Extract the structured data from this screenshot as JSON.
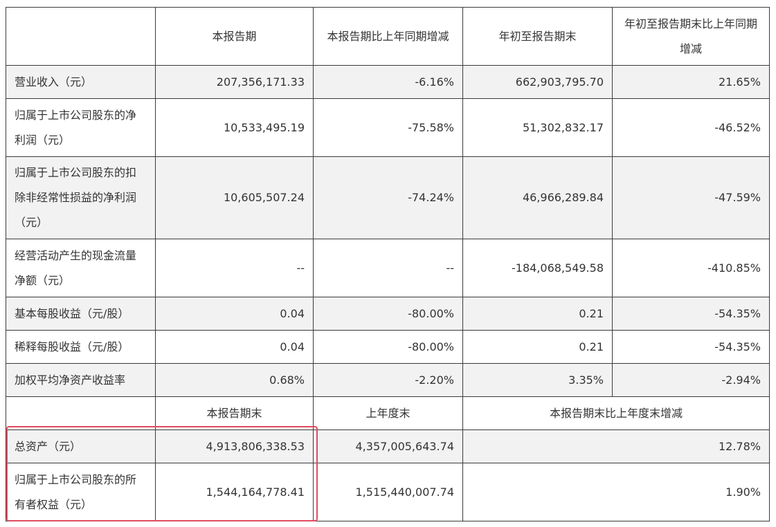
{
  "highlight_color": "#e24b5f",
  "header": {
    "cols": [
      "",
      "本报告期",
      "本报告期比上年同期增减",
      "年初至报告期末",
      "年初至报告期末比上年同期增减"
    ]
  },
  "rows": [
    {
      "label": "营业收入（元）",
      "cells": [
        "207,356,171.33",
        "-6.16%",
        "662,903,795.70",
        "21.65%"
      ]
    },
    {
      "label": "归属于上市公司股东的净利润（元）",
      "cells": [
        "10,533,495.19",
        "-75.58%",
        "51,302,832.17",
        "-46.52%"
      ]
    },
    {
      "label": "归属于上市公司股东的扣除非经常性损益的净利润（元）",
      "cells": [
        "10,605,507.24",
        "-74.24%",
        "46,966,289.84",
        "-47.59%"
      ]
    },
    {
      "label": "经营活动产生的现金流量净额（元）",
      "cells": [
        "--",
        "--",
        "-184,068,549.58",
        "-410.85%"
      ]
    },
    {
      "label": "基本每股收益（元/股）",
      "cells": [
        "0.04",
        "-80.00%",
        "0.21",
        "-54.35%"
      ]
    },
    {
      "label": "稀释每股收益（元/股）",
      "cells": [
        "0.04",
        "-80.00%",
        "0.21",
        "-54.35%"
      ]
    },
    {
      "label": "加权平均净资产收益率",
      "cells": [
        "0.68%",
        "-2.20%",
        "3.35%",
        "-2.94%"
      ]
    }
  ],
  "subheader": {
    "cols": [
      "",
      "本报告期末",
      "上年度末",
      "本报告期末比上年度末增减"
    ]
  },
  "rows2": [
    {
      "label": "总资产（元）",
      "cells": [
        "4,913,806,338.53",
        "4,357,005,643.74",
        "12.78%"
      ]
    },
    {
      "label": "归属于上市公司股东的所有者权益（元）",
      "cells": [
        "1,544,164,778.41",
        "1,515,440,007.74",
        "1.90%"
      ]
    }
  ]
}
